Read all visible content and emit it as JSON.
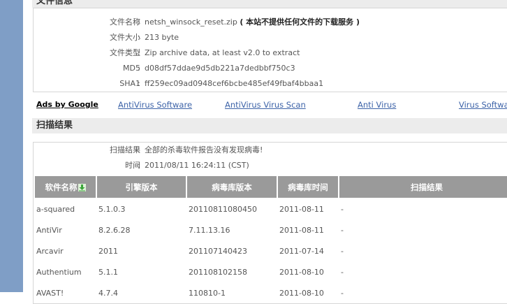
{
  "file_info": {
    "section_title": "文件信息",
    "rows": [
      {
        "key": "文件名称",
        "value": "netsh_winsock_reset.zip",
        "note": "( 本站不提供任何文件的下载服务 )"
      },
      {
        "key": "文件大小",
        "value": "213 byte"
      },
      {
        "key": "文件类型",
        "value": "Zip archive data, at least v2.0 to extract"
      },
      {
        "key": "MD5",
        "value": "d08df57ddae9d5db221a7dedbbf750c3"
      },
      {
        "key": "SHA1",
        "value": "ff259ec09ad0948cef6bcbe485ef49fbaf4bbaa1"
      }
    ],
    "colon": ":"
  },
  "ads": {
    "label": "Ads by Google",
    "links": [
      "AntiVirus Software",
      "AntiVirus Virus Scan",
      "Anti Virus",
      "Virus Software"
    ]
  },
  "scan": {
    "section_title": "扫描结果",
    "summary": [
      {
        "key": "扫描结果",
        "value": "全部的杀毒软件报告没有发现病毒!"
      },
      {
        "key": "时间",
        "value": "2011/08/11 16:24:11 (CST)"
      }
    ],
    "columns": [
      "软件名称",
      "引擎版本",
      "病毒库版本",
      "病毒库时间",
      "扫描结果"
    ],
    "rows": [
      [
        "a-squared",
        "5.1.0.3",
        "20110811080450",
        "2011-08-11",
        "-"
      ],
      [
        "AntiVir",
        "8.2.6.28",
        "7.11.13.16",
        "2011-08-11",
        "-"
      ],
      [
        "Arcavir",
        "2011",
        "201107140423",
        "2011-07-14",
        "-"
      ],
      [
        "Authentium",
        "5.1.1",
        "201108102158",
        "2011-08-10",
        "-"
      ],
      [
        "AVAST!",
        "4.7.4",
        "110810-1",
        "2011-08-10",
        "-"
      ]
    ]
  },
  "colors": {
    "left_strip": "#7f9ec6",
    "header_bg": "#9a9a9a",
    "link": "#3d63a8",
    "sort_arrow": "#3aa53a"
  }
}
